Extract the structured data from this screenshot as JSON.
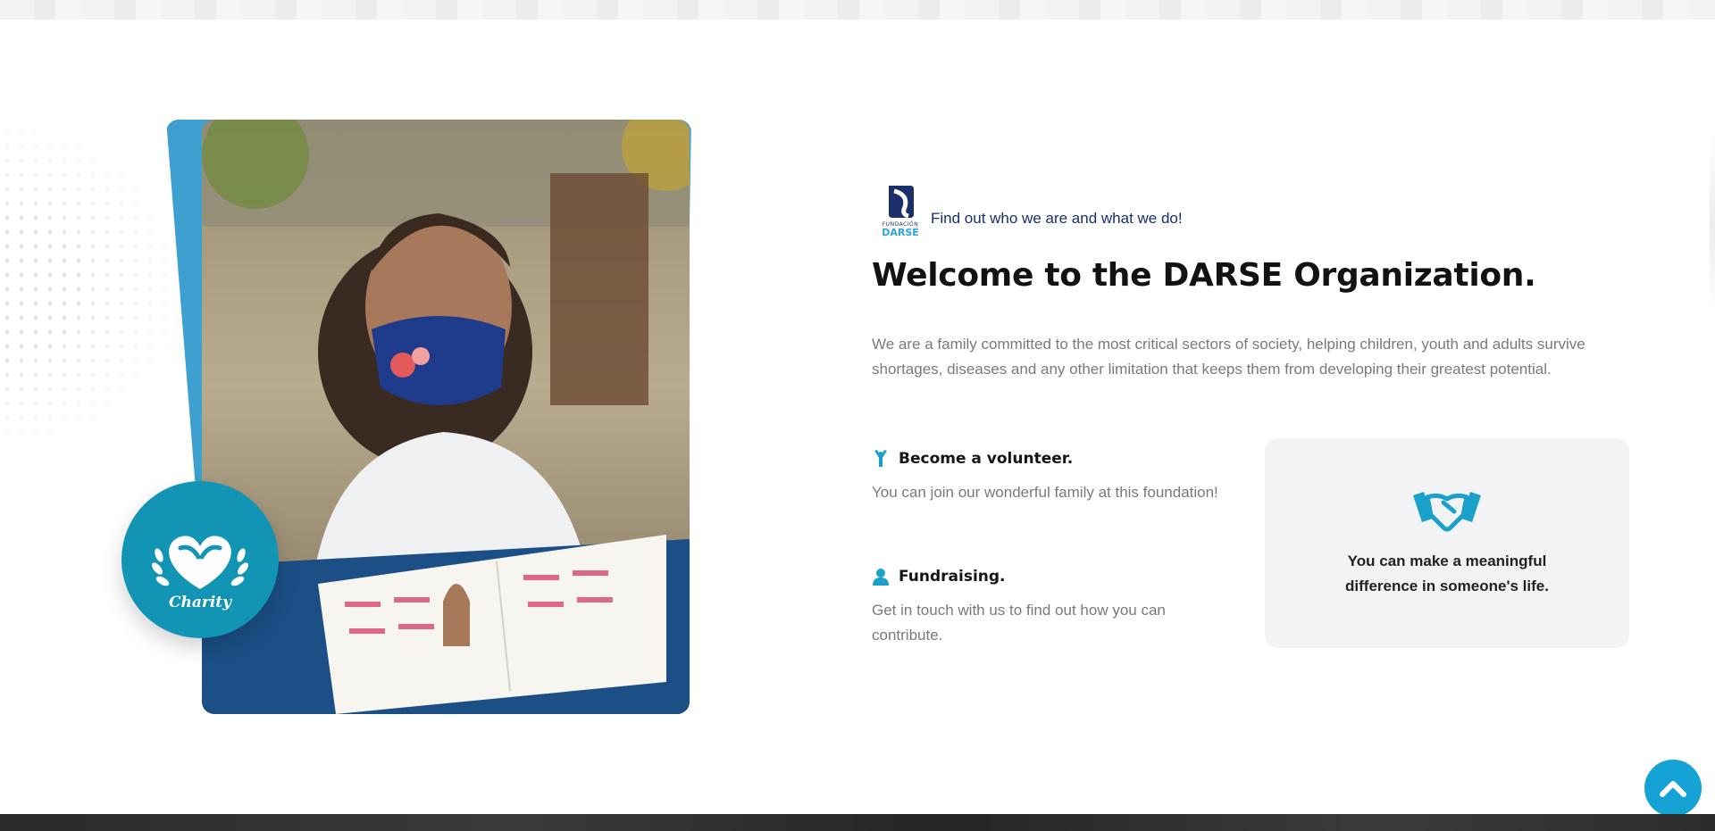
{
  "intro": {
    "logo_small": "FUNDACIÓN",
    "logo_big": "DARSE",
    "tagline": "Find out who we are and what we do!"
  },
  "main": {
    "title": "Welcome to the DARSE Organization.",
    "description": "We are a family committed to the most critical sectors of society, helping children, youth and adults survive shortages, diseases and any other limitation that keeps them from developing their greatest potential."
  },
  "badge": {
    "label": "Charity",
    "icon": "heart-hands-icon"
  },
  "features": [
    {
      "title": "Become a volunteer.",
      "text": "You can join our wonderful family at this foundation!",
      "icon": "person-raising-hand-icon"
    },
    {
      "title": "Fundraising.",
      "text": "Get in touch with us to find out how you can contribute.",
      "icon": "person-icon"
    }
  ],
  "card": {
    "text": "You can make a meaningful difference in someone's life.",
    "icon": "handshake-icon"
  },
  "scroll_top": {
    "icon": "chevron-up-icon"
  },
  "colors": {
    "accent": "#1295b5",
    "brand_navy": "#1a2e6e",
    "frame_blue": "#3ea0d0",
    "scroll_button": "#15a3d6"
  }
}
